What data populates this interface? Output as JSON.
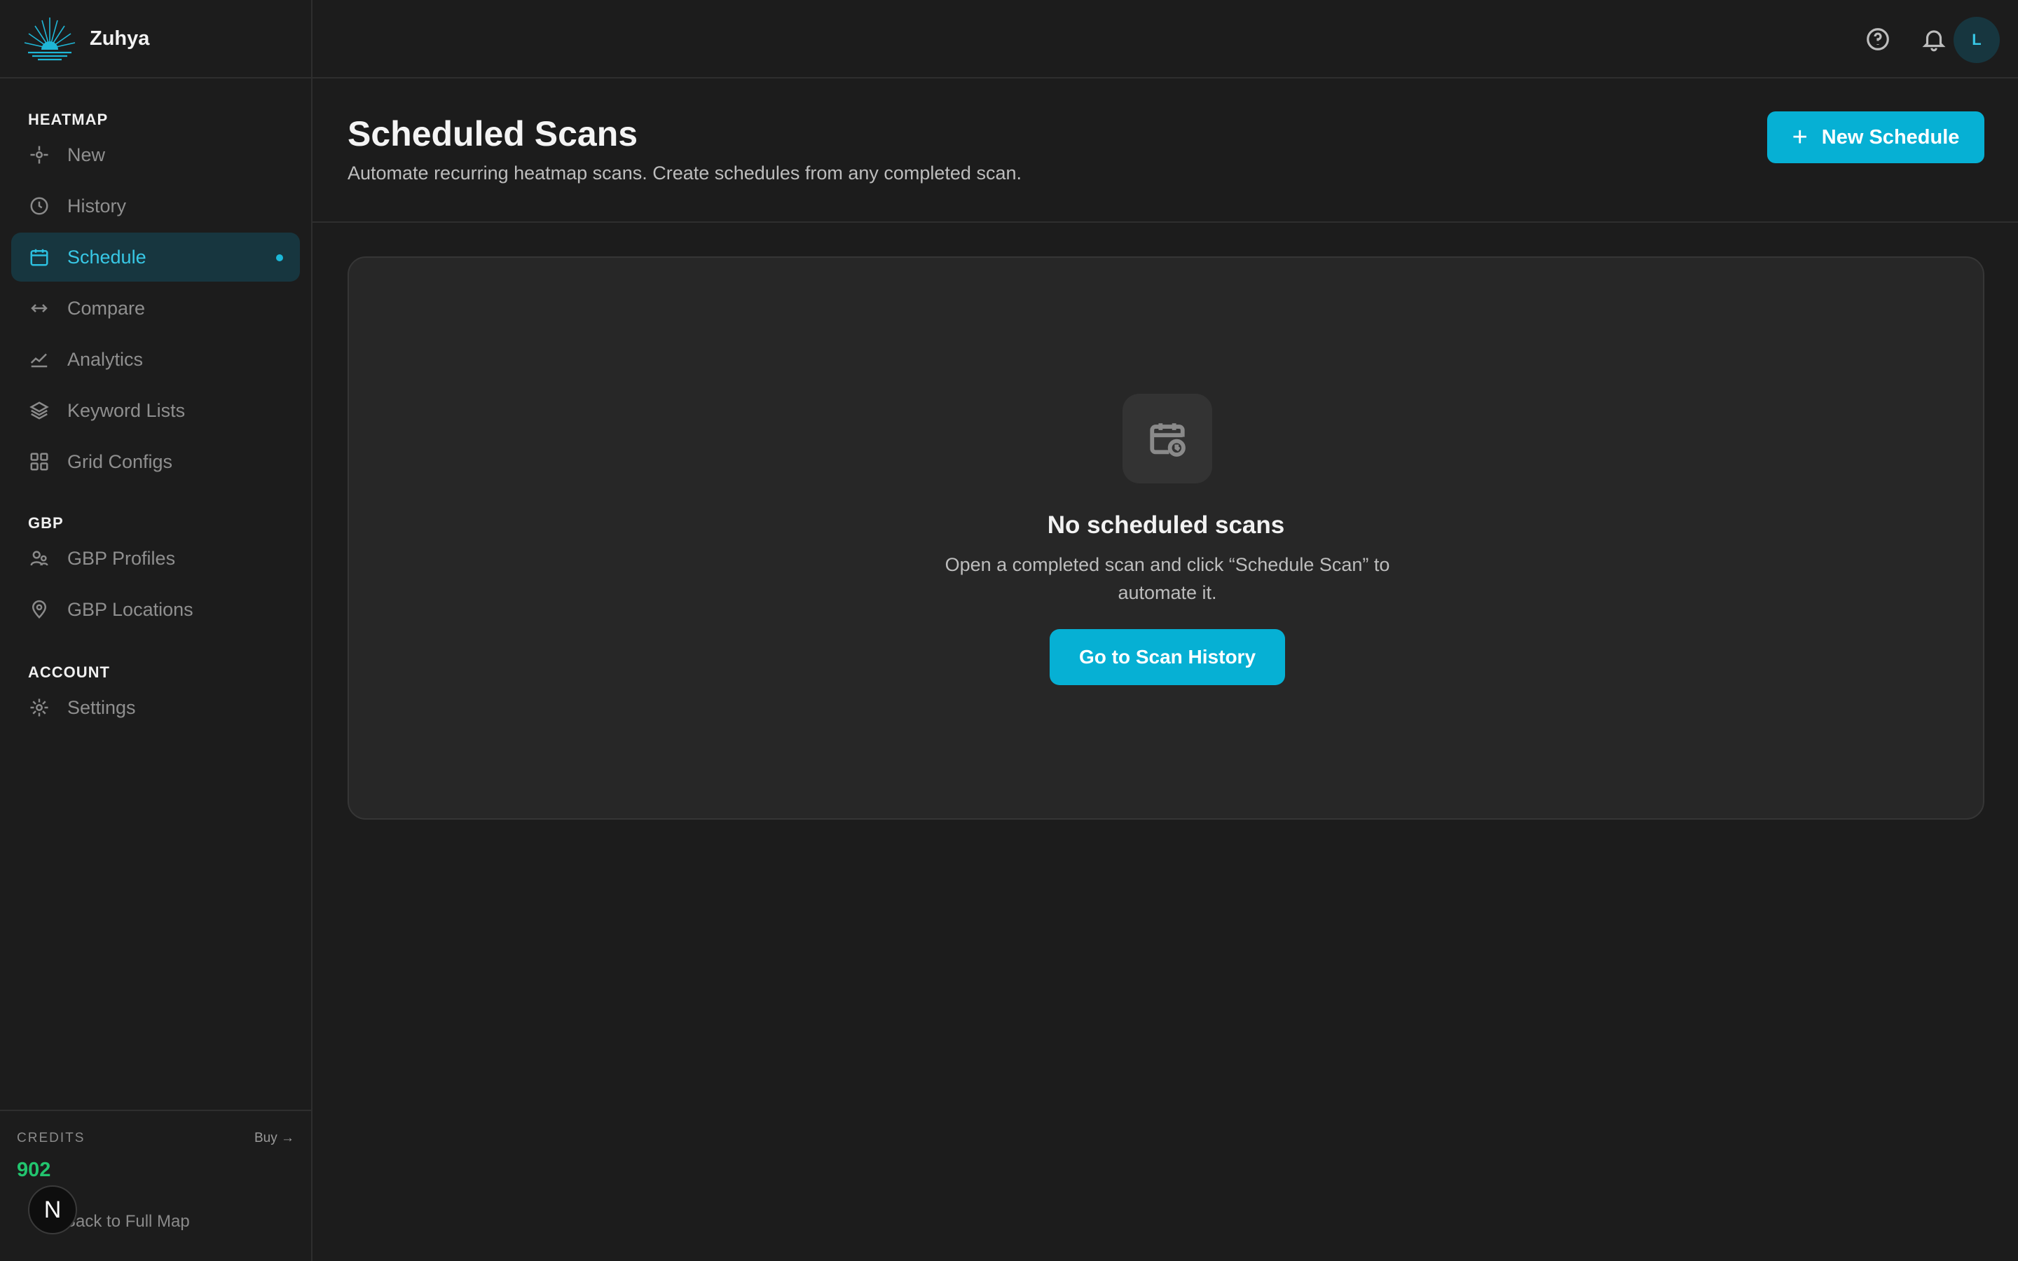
{
  "app": {
    "name": "Zuhya"
  },
  "sidebar": {
    "sections": [
      {
        "label": "HEATMAP",
        "items": [
          {
            "label": "New",
            "icon": "crosshair-icon"
          },
          {
            "label": "History",
            "icon": "clock-icon"
          },
          {
            "label": "Schedule",
            "icon": "calendar-icon",
            "active": true
          },
          {
            "label": "Compare",
            "icon": "arrows-horizontal-icon"
          },
          {
            "label": "Analytics",
            "icon": "line-chart-icon"
          },
          {
            "label": "Keyword Lists",
            "icon": "layers-icon"
          },
          {
            "label": "Grid Configs",
            "icon": "grid-icon"
          }
        ]
      },
      {
        "label": "GBP",
        "items": [
          {
            "label": "GBP Profiles",
            "icon": "users-icon"
          },
          {
            "label": "GBP Locations",
            "icon": "map-pin-icon"
          }
        ]
      },
      {
        "label": "ACCOUNT",
        "items": [
          {
            "label": "Settings",
            "icon": "gear-icon"
          }
        ]
      }
    ],
    "footer": {
      "credits_label": "CREDITS",
      "buy_label": "Buy →",
      "credits_value": "902",
      "back_link": "Back to Full Map",
      "badge": "N"
    }
  },
  "topbar": {
    "avatar_initial": "L"
  },
  "page": {
    "title": "Scheduled Scans",
    "subtitle": "Automate recurring heatmap scans. Create schedules from any completed scan.",
    "new_button": "New Schedule"
  },
  "empty_state": {
    "title": "No scheduled scans",
    "description": "Open a completed scan and click “Schedule Scan” to automate it.",
    "button": "Go to Scan History"
  },
  "colors": {
    "accent": "#06b0d4",
    "active_bg": "#17363f",
    "credits": "#22c46e",
    "background": "#1c1c1c",
    "card": "#272727"
  }
}
